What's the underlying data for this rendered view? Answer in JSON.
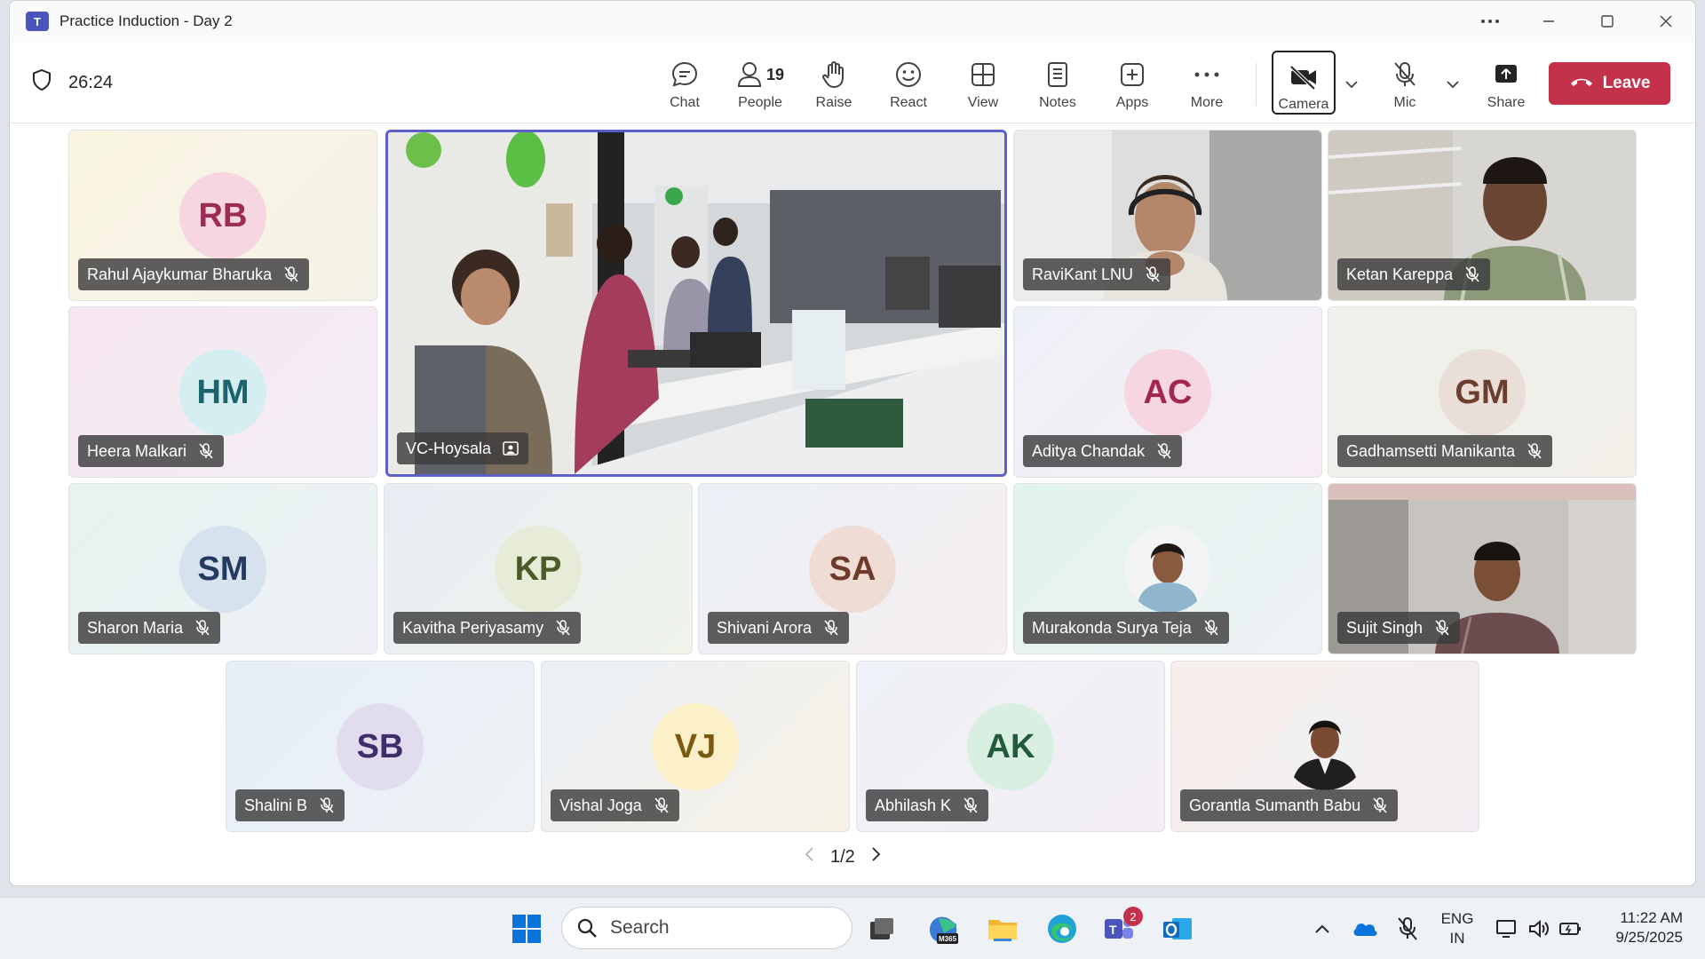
{
  "window": {
    "title": "Practice Induction - Day 2",
    "app_icon_text": "T",
    "controls": [
      "more-options",
      "minimize",
      "maximize",
      "close"
    ]
  },
  "meeting": {
    "timer": "26:24",
    "toolbar": {
      "chat": "Chat",
      "people": "People",
      "people_count": "19",
      "raise": "Raise",
      "react": "React",
      "view": "View",
      "notes": "Notes",
      "apps": "Apps",
      "more": "More",
      "camera": "Camera",
      "mic": "Mic",
      "share": "Share",
      "leave": "Leave"
    },
    "colors": {
      "accent": "#5b5fc7",
      "leave": "#c4314b"
    }
  },
  "participants": [
    {
      "name": "Rahul Ajaykumar Bharuka",
      "initials": "RB",
      "muted": true
    },
    {
      "name": "VC-Hoysala",
      "initials": "",
      "muted": false,
      "video": true,
      "icon": "room-icon"
    },
    {
      "name": "RaviKant LNU",
      "initials": "",
      "muted": true,
      "video": true
    },
    {
      "name": "Ketan Kareppa",
      "initials": "",
      "muted": true,
      "video": true
    },
    {
      "name": "Heera Malkari",
      "initials": "HM",
      "muted": true
    },
    {
      "name": "Aditya Chandak",
      "initials": "AC",
      "muted": true
    },
    {
      "name": "Gadhamsetti Manikanta",
      "initials": "GM",
      "muted": true
    },
    {
      "name": "Sharon Maria",
      "initials": "SM",
      "muted": true
    },
    {
      "name": "Kavitha Periyasamy",
      "initials": "KP",
      "muted": true
    },
    {
      "name": "Shivani Arora",
      "initials": "SA",
      "muted": true
    },
    {
      "name": "Murakonda Surya Teja",
      "initials": "",
      "muted": true,
      "photo": true
    },
    {
      "name": "Sujit Singh",
      "initials": "",
      "muted": true,
      "video": true
    },
    {
      "name": "Shalini B",
      "initials": "SB",
      "muted": true
    },
    {
      "name": "Vishal Joga",
      "initials": "VJ",
      "muted": true
    },
    {
      "name": "Abhilash K",
      "initials": "AK",
      "muted": true
    },
    {
      "name": "Gorantla Sumanth Babu",
      "initials": "",
      "muted": true,
      "photo": true
    }
  ],
  "pager": {
    "label": "1/2"
  },
  "taskbar": {
    "search_placeholder": "Search",
    "teams_badge": "2",
    "language_line1": "ENG",
    "language_line2": "IN",
    "time": "11:22 AM",
    "date": "9/25/2025",
    "m365_label": "M365"
  }
}
